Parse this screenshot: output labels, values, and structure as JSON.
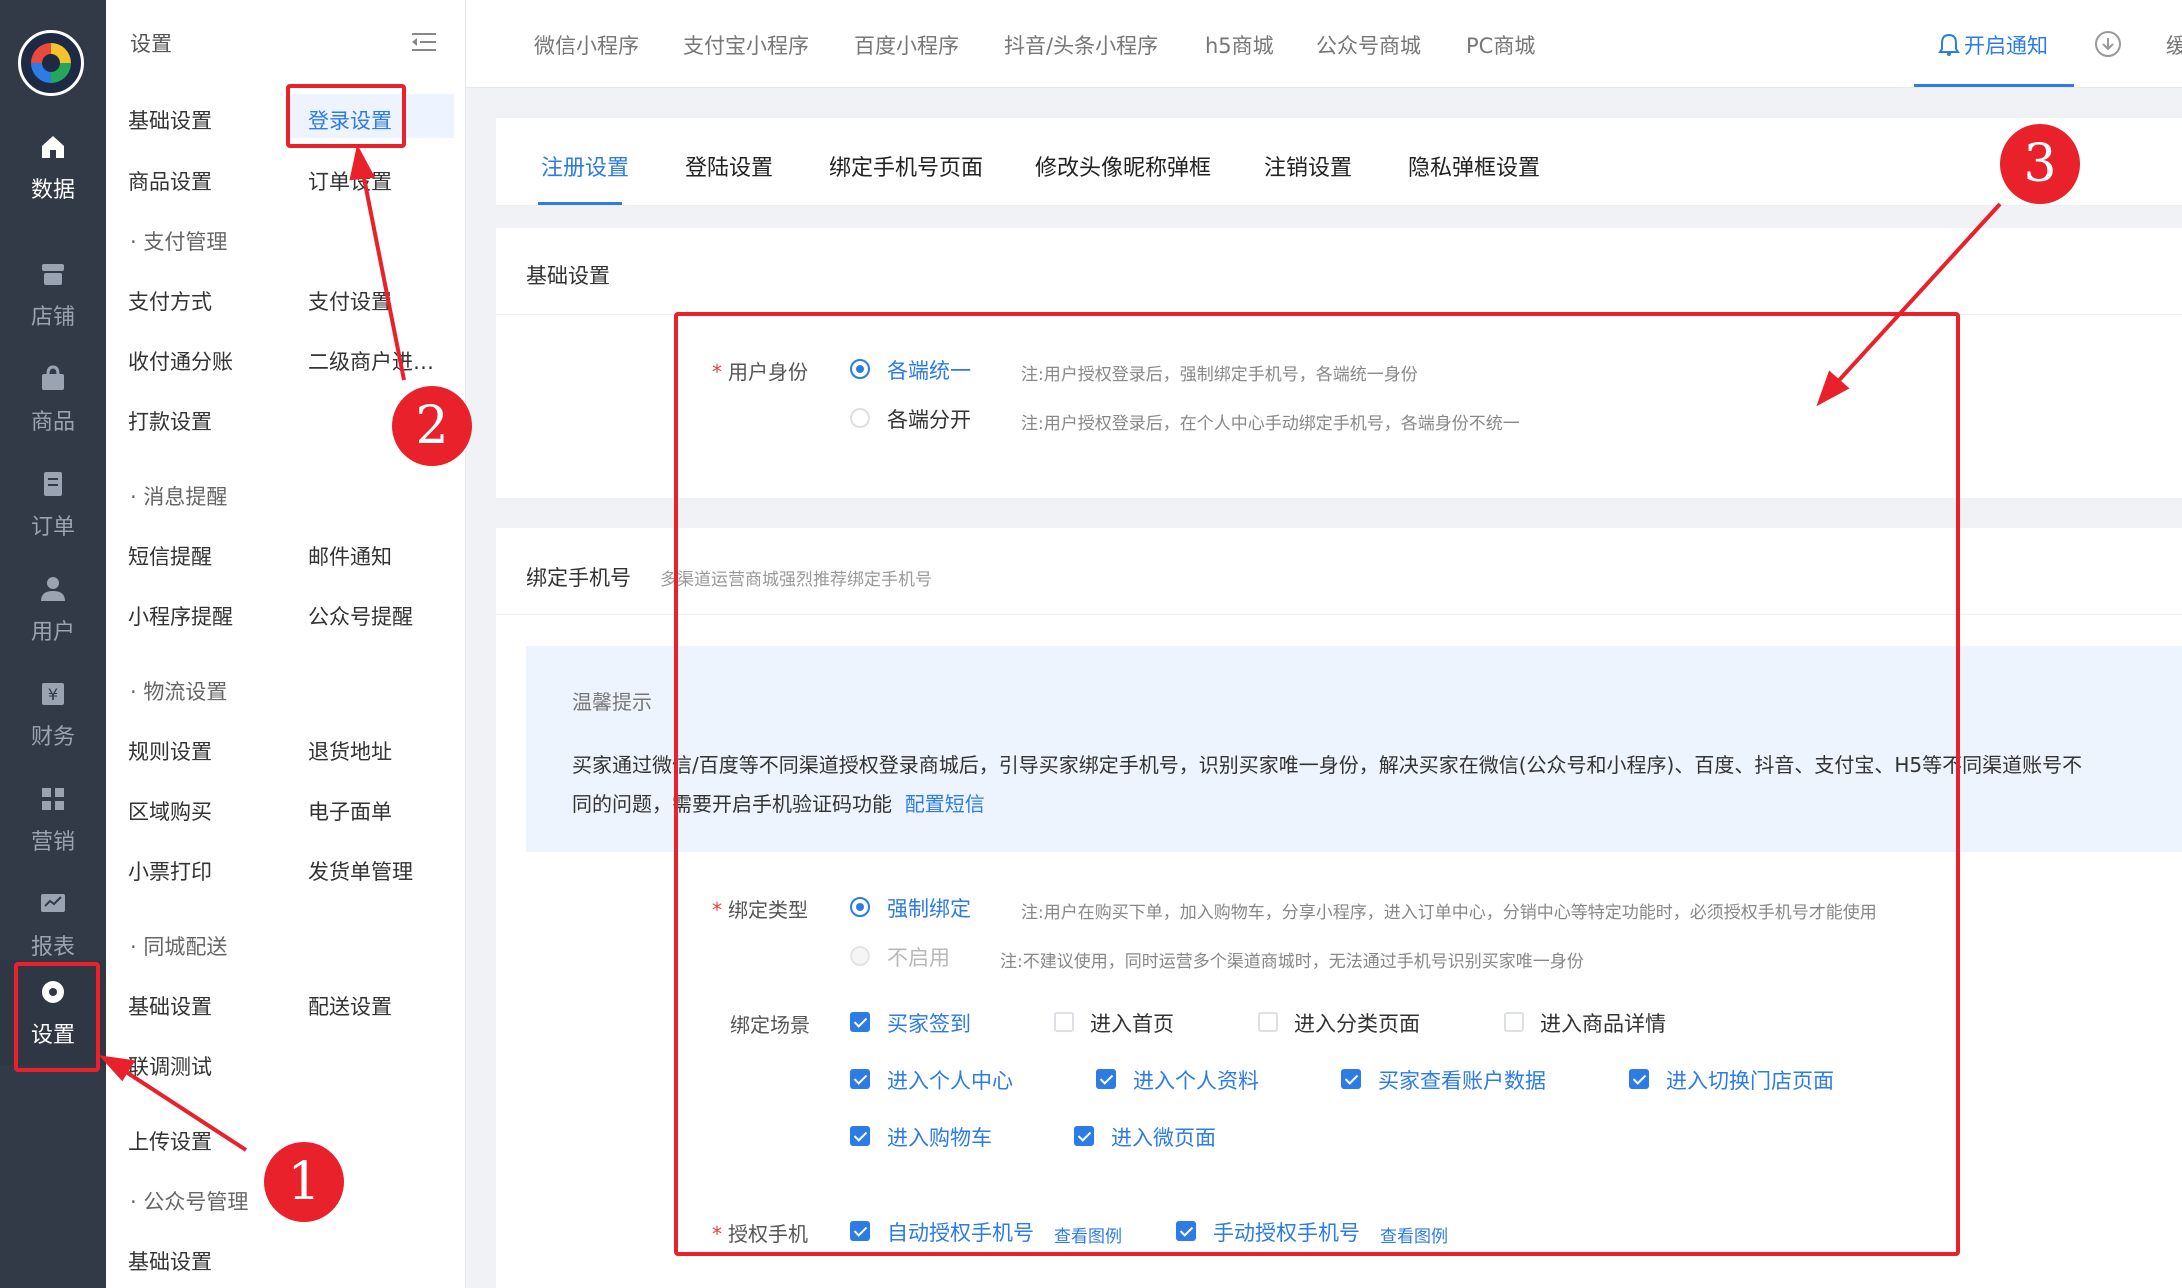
{
  "nav": {
    "items": [
      {
        "label": "数据",
        "icon": "home-icon"
      },
      {
        "label": "店铺",
        "icon": "store-icon"
      },
      {
        "label": "商品",
        "icon": "bag-icon"
      },
      {
        "label": "订单",
        "icon": "order-icon"
      },
      {
        "label": "用户",
        "icon": "user-icon"
      },
      {
        "label": "财务",
        "icon": "finance-icon"
      },
      {
        "label": "营销",
        "icon": "marketing-icon"
      },
      {
        "label": "报表",
        "icon": "report-icon"
      },
      {
        "label": "设置",
        "icon": "gear-icon"
      }
    ]
  },
  "submenu": {
    "title": "设置",
    "rows": [
      [
        "基础设置",
        "登录设置"
      ],
      [
        "商品设置",
        "订单设置"
      ],
      [
        "支付方式",
        "支付设置"
      ],
      [
        "收付通分账",
        "二级商户进…"
      ],
      [
        "打款设置",
        ""
      ],
      [
        "短信提醒",
        "邮件通知"
      ],
      [
        "小程序提醒",
        "公众号提醒"
      ],
      [
        "规则设置",
        "退货地址"
      ],
      [
        "区域购买",
        "电子面单"
      ],
      [
        "小票打印",
        "发货单管理"
      ],
      [
        "基础设置",
        "配送设置"
      ],
      [
        "联调测试",
        ""
      ],
      [
        "上传设置",
        ""
      ],
      [
        "基础设置",
        ""
      ]
    ],
    "groups": [
      "支付管理",
      "消息提醒",
      "物流设置",
      "同城配送",
      "公众号管理"
    ]
  },
  "topbar": {
    "tabs": [
      "微信小程序",
      "支付宝小程序",
      "百度小程序",
      "抖音/头条小程序",
      "h5商城",
      "公众号商城",
      "PC商城"
    ],
    "notify": "开启通知",
    "cut": "缓"
  },
  "content_tabs": [
    "注册设置",
    "登陆设置",
    "绑定手机号页面",
    "修改头像昵称弹框",
    "注销设置",
    "隐私弹框设置"
  ],
  "basic": {
    "title": "基础设置",
    "identity_label": "用户身份",
    "options": [
      {
        "label": "各端统一",
        "note": "注:用户授权登录后，强制绑定手机号，各端统一身份"
      },
      {
        "label": "各端分开",
        "note": "注:用户授权登录后，在个人中心手动绑定手机号，各端身份不统一"
      }
    ]
  },
  "bind": {
    "title": "绑定手机号",
    "subtitle": "多渠道运营商城强烈推荐绑定手机号",
    "tip_title": "温馨提示",
    "tip_text": "买家通过微信/百度等不同渠道授权登录商城后，引导买家绑定手机号，识别买家唯一身份，解决买家在微信(公众号和小程序)、百度、抖音、支付宝、H5等不同渠道账号不同的问题，需要开启手机验证码功能",
    "tip_link": "配置短信",
    "type_label": "绑定类型",
    "type_options": [
      {
        "label": "强制绑定",
        "note": "注:用户在购买下单，加入购物车，分享小程序，进入订单中心，分销中心等特定功能时，必须授权手机号才能使用"
      },
      {
        "label": "不启用",
        "note": "注:不建议使用，同时运营多个渠道商城时，无法通过手机号识别买家唯一身份"
      }
    ],
    "scene_label": "绑定场景",
    "scenes": [
      {
        "label": "买家签到",
        "checked": true
      },
      {
        "label": "进入首页",
        "checked": false
      },
      {
        "label": "进入分类页面",
        "checked": false
      },
      {
        "label": "进入商品详情",
        "checked": false
      },
      {
        "label": "进入个人中心",
        "checked": true
      },
      {
        "label": "进入个人资料",
        "checked": true
      },
      {
        "label": "买家查看账户数据",
        "checked": true
      },
      {
        "label": "进入切换门店页面",
        "checked": true
      },
      {
        "label": "进入购物车",
        "checked": true
      },
      {
        "label": "进入微页面",
        "checked": true
      }
    ],
    "auth_label": "授权手机",
    "auth_options": [
      {
        "label": "自动授权手机号",
        "link": "查看图例"
      },
      {
        "label": "手动授权手机号",
        "link": "查看图例"
      }
    ]
  },
  "annotations": [
    "1",
    "2",
    "3"
  ],
  "colors": {
    "accent": "#2d7be5",
    "annotation": "#e8212b",
    "nav_bg": "#323a47"
  }
}
